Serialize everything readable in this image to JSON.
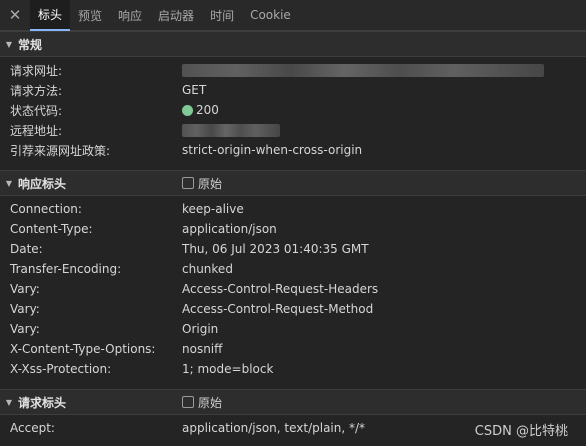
{
  "tabs": {
    "close_glyph": "✕",
    "items": [
      "标头",
      "预览",
      "响应",
      "启动器",
      "时间",
      "Cookie"
    ],
    "active": "标头"
  },
  "general": {
    "title": "常规",
    "rows": [
      {
        "key": "请求网址:",
        "value": ""
      },
      {
        "key": "请求方法:",
        "value": "GET"
      },
      {
        "key": "状态代码:",
        "value": "200"
      },
      {
        "key": "远程地址:",
        "value": ""
      },
      {
        "key": "引荐来源网址政策:",
        "value": "strict-origin-when-cross-origin"
      }
    ]
  },
  "response_headers": {
    "title": "响应标头",
    "raw_label": "原始",
    "rows": [
      {
        "key": "Connection:",
        "value": "keep-alive"
      },
      {
        "key": "Content-Type:",
        "value": "application/json"
      },
      {
        "key": "Date:",
        "value": "Thu, 06 Jul 2023 01:40:35 GMT"
      },
      {
        "key": "Transfer-Encoding:",
        "value": "chunked"
      },
      {
        "key": "Vary:",
        "value": "Access-Control-Request-Headers"
      },
      {
        "key": "Vary:",
        "value": "Access-Control-Request-Method"
      },
      {
        "key": "Vary:",
        "value": "Origin"
      },
      {
        "key": "X-Content-Type-Options:",
        "value": "nosniff"
      },
      {
        "key": "X-Xss-Protection:",
        "value": "1; mode=block"
      }
    ]
  },
  "request_headers": {
    "title": "请求标头",
    "raw_label": "原始",
    "rows": [
      {
        "key": "Accept:",
        "value": "application/json, text/plain, */*"
      }
    ]
  },
  "watermark": "CSDN @比特桃",
  "colors": {
    "background": "#242424",
    "status_ok": "#81c995",
    "active_tab_underline": "#8ab4f8"
  }
}
